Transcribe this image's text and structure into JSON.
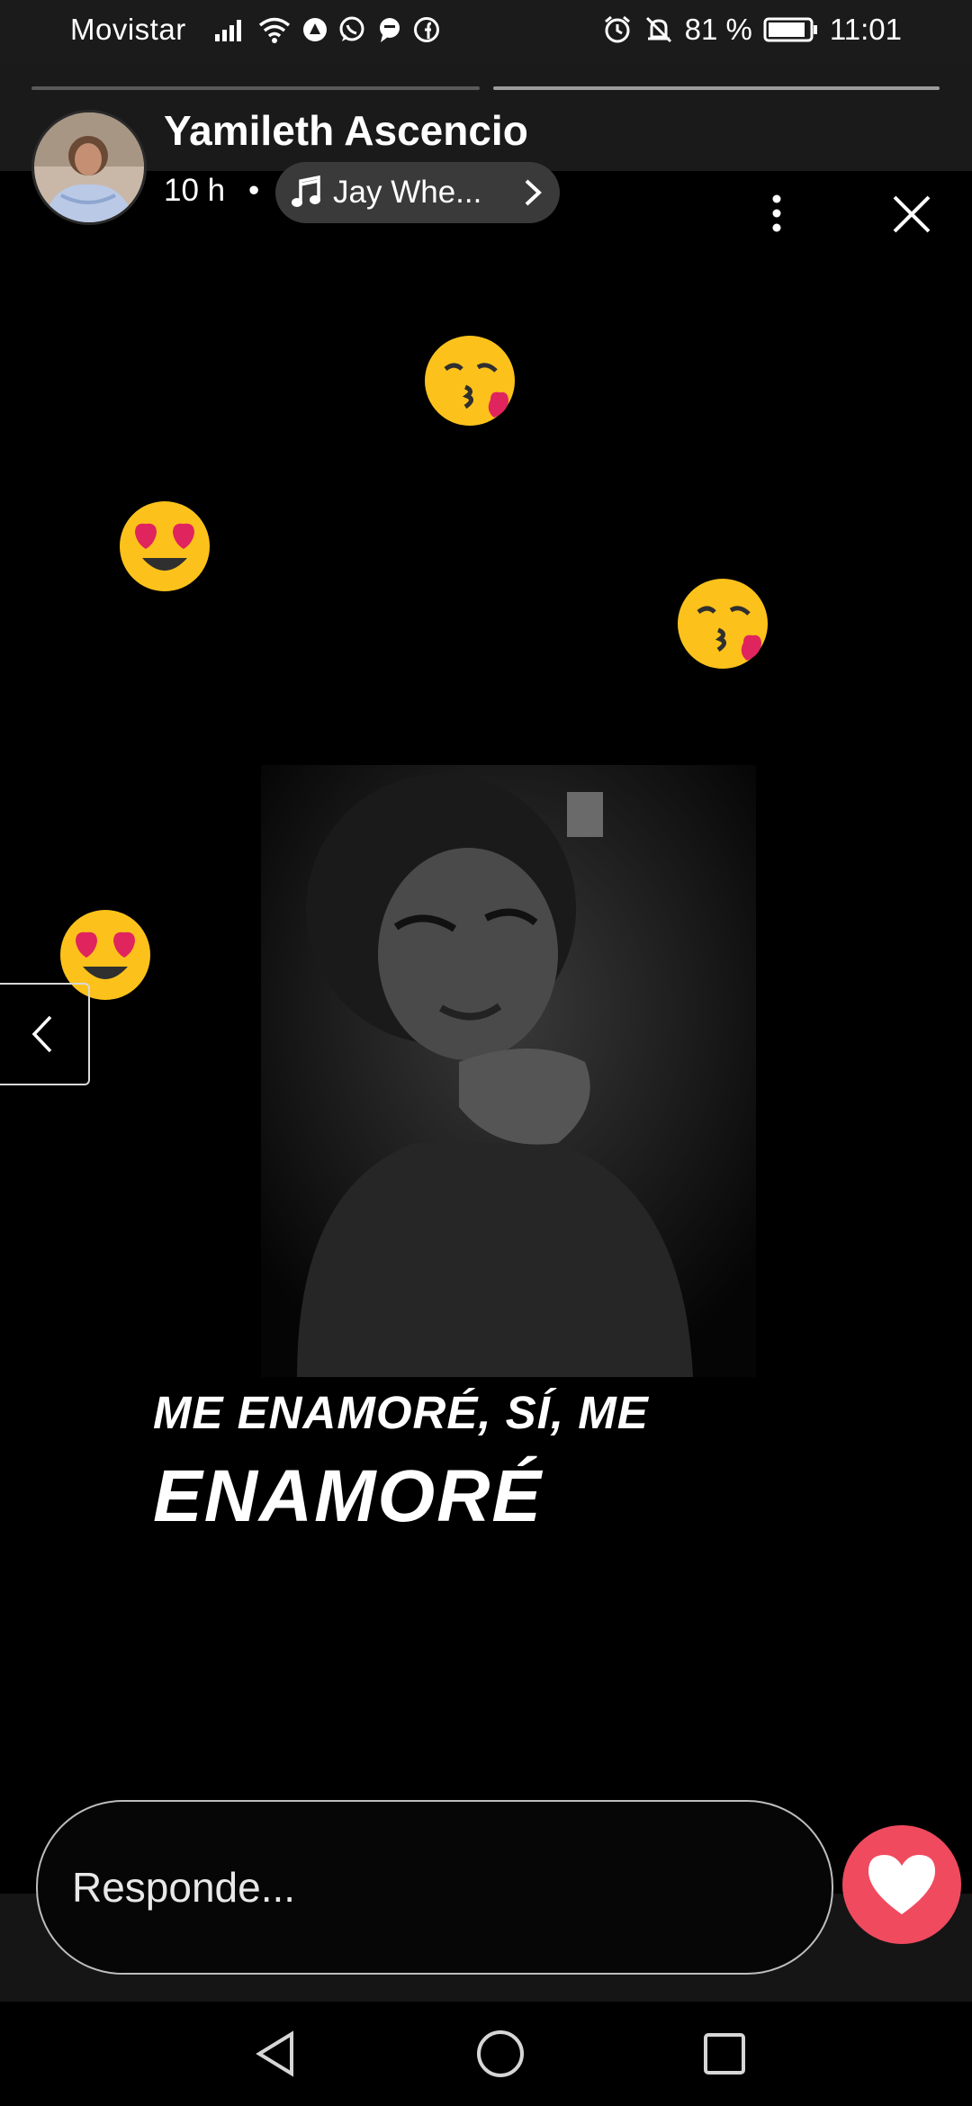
{
  "status_bar": {
    "carrier": "Movistar",
    "battery": "81 %",
    "time": "11:01",
    "icons": [
      "signal-icon",
      "wifi-icon",
      "app-icon",
      "whatsapp-icon",
      "chat-icon",
      "facebook-icon",
      "alarm-icon",
      "mute-icon",
      "battery-icon"
    ]
  },
  "story": {
    "user_name": "Yamileth Ascencio",
    "age": "10 h",
    "separator": "•",
    "music": "Jay Whe...",
    "caption_line1": "ME ENAMORÉ, SÍ, ME",
    "caption_line2": "ENAMORÉ",
    "emojis": [
      "kissing-heart-emoji",
      "heart-eyes-emoji",
      "kissing-heart-emoji",
      "heart-eyes-emoji"
    ]
  },
  "reply": {
    "placeholder": "Responde..."
  },
  "colors": {
    "like_button": "#f04a5f",
    "background": "#000000"
  }
}
